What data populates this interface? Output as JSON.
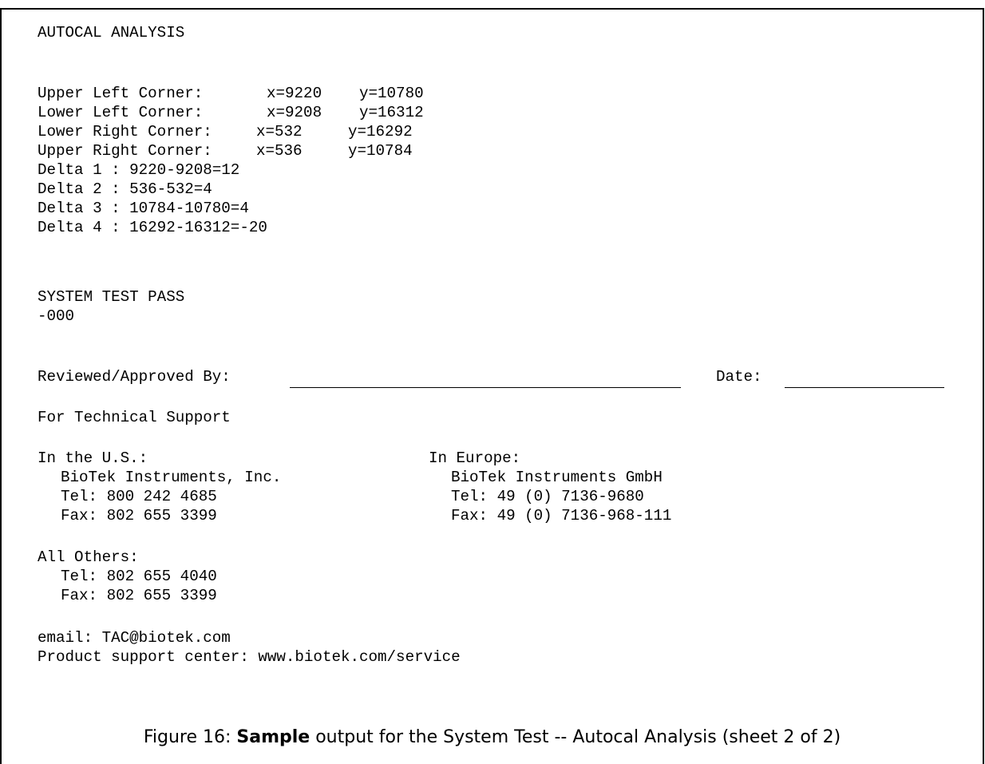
{
  "report": {
    "title": "AUTOCAL ANALYSIS",
    "corners": [
      {
        "label": "Upper Left Corner: ",
        "x": "x=9220",
        "y": "y=10780"
      },
      {
        "label": "Lower Left Corner: ",
        "x": "x=9208",
        "y": "y=16312"
      },
      {
        "label": "Lower Right Corner:",
        "x": "x=532",
        "y": "y=16292"
      },
      {
        "label": "Upper Right Corner:",
        "x": "x=536",
        "y": "y=10784"
      }
    ],
    "deltas": [
      "Delta 1 : 9220-9208=12",
      "Delta 2 : 536-532=4",
      "Delta 3 : 10784-10780=4",
      "Delta 4 : 16292-16312=-20"
    ],
    "result": "SYSTEM TEST PASS",
    "code": "-000"
  },
  "signoff": {
    "reviewed_label": "Reviewed/Approved By:",
    "date_label": "Date:"
  },
  "support": {
    "heading": "For Technical Support",
    "us": {
      "label": "In the U.S.:",
      "company": "BioTek Instruments, Inc.",
      "tel": "Tel: 800 242 4685",
      "fax": "Fax: 802 655 3399"
    },
    "europe": {
      "label": "In Europe:",
      "company": "BioTek Instruments GmbH",
      "tel": "Tel: 49 (0) 7136-9680",
      "fax": "Fax: 49 (0) 7136-968-111"
    },
    "others": {
      "label": "All Others:",
      "tel": "Tel: 802 655 4040",
      "fax": "Fax: 802 655 3399"
    },
    "email": "email: TAC@biotek.com",
    "product_center": "Product support center: www.biotek.com/service"
  },
  "caption": {
    "prefix": "Figure 16: ",
    "bold": "Sample",
    "suffix": " output for the System Test -- Autocal Analysis (sheet 2 of 2)"
  }
}
